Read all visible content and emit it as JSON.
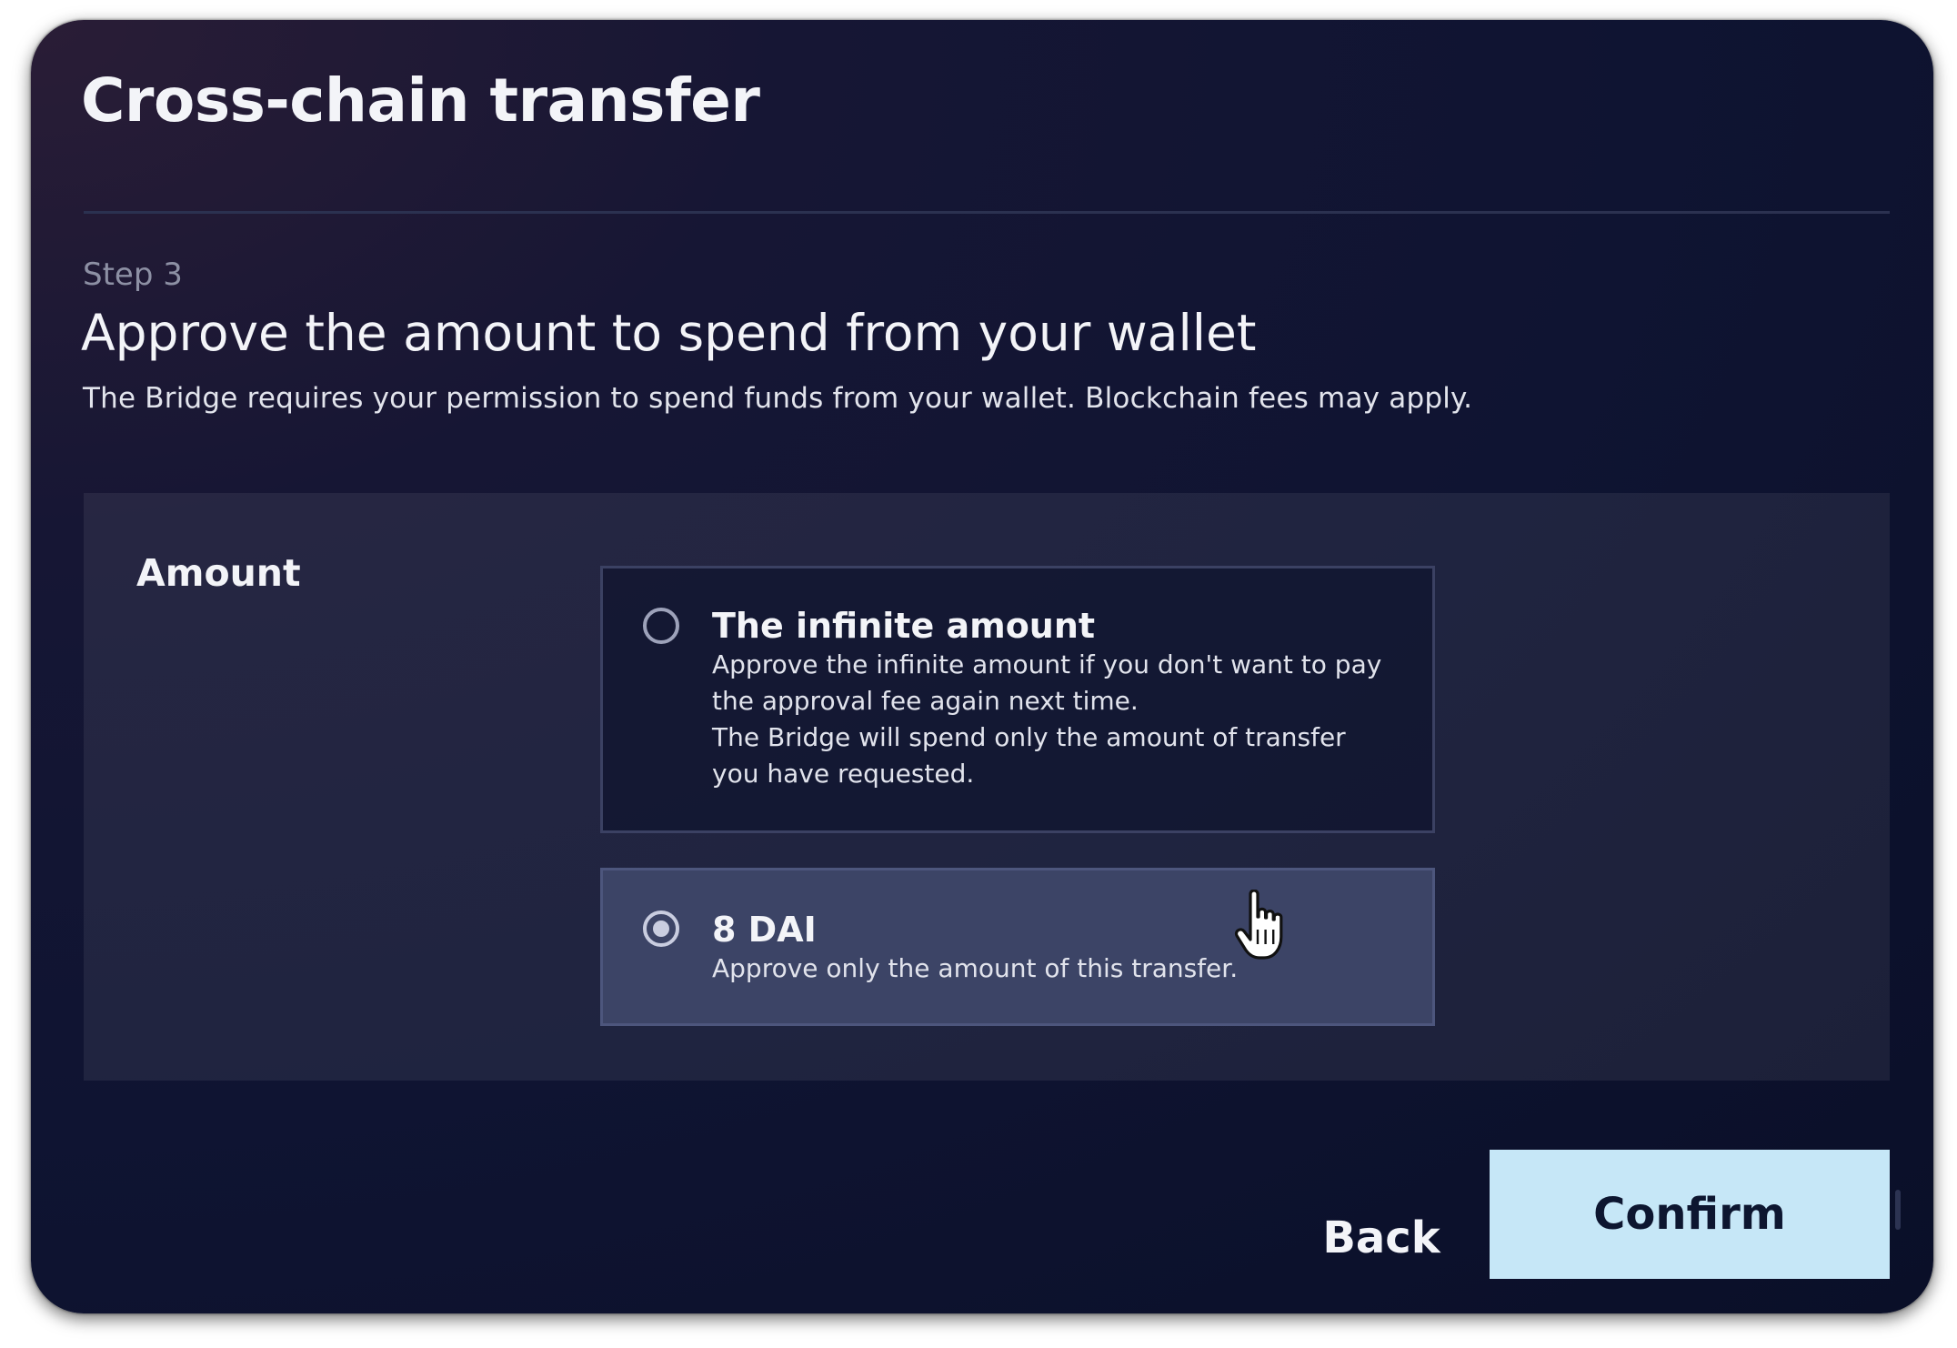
{
  "dialog": {
    "title": "Cross-chain transfer"
  },
  "step": {
    "label": "Step 3",
    "heading": "Approve the amount to spend from your wallet",
    "description": "The Bridge requires your permission to spend funds from your wallet. Blockchain fees may apply."
  },
  "amount": {
    "label": "Amount",
    "options": [
      {
        "title": "The infinite amount",
        "description_line1": "Approve the infinite amount if you don't want to pay",
        "description_line2": "the approval fee again next time.",
        "description_line3": "The Bridge will spend only the amount of transfer",
        "description_line4": "you have requested.",
        "selected": false
      },
      {
        "title": "8 DAI",
        "description": "Approve only the amount of this transfer.",
        "selected": true
      }
    ]
  },
  "actions": {
    "back_label": "Back",
    "confirm_label": "Confirm"
  },
  "colors": {
    "background": "#0f1432",
    "confirm_button": "#c6e7f7",
    "selected_option": "#3c4466"
  },
  "icons": {
    "cursor": "hand-pointer-icon"
  }
}
